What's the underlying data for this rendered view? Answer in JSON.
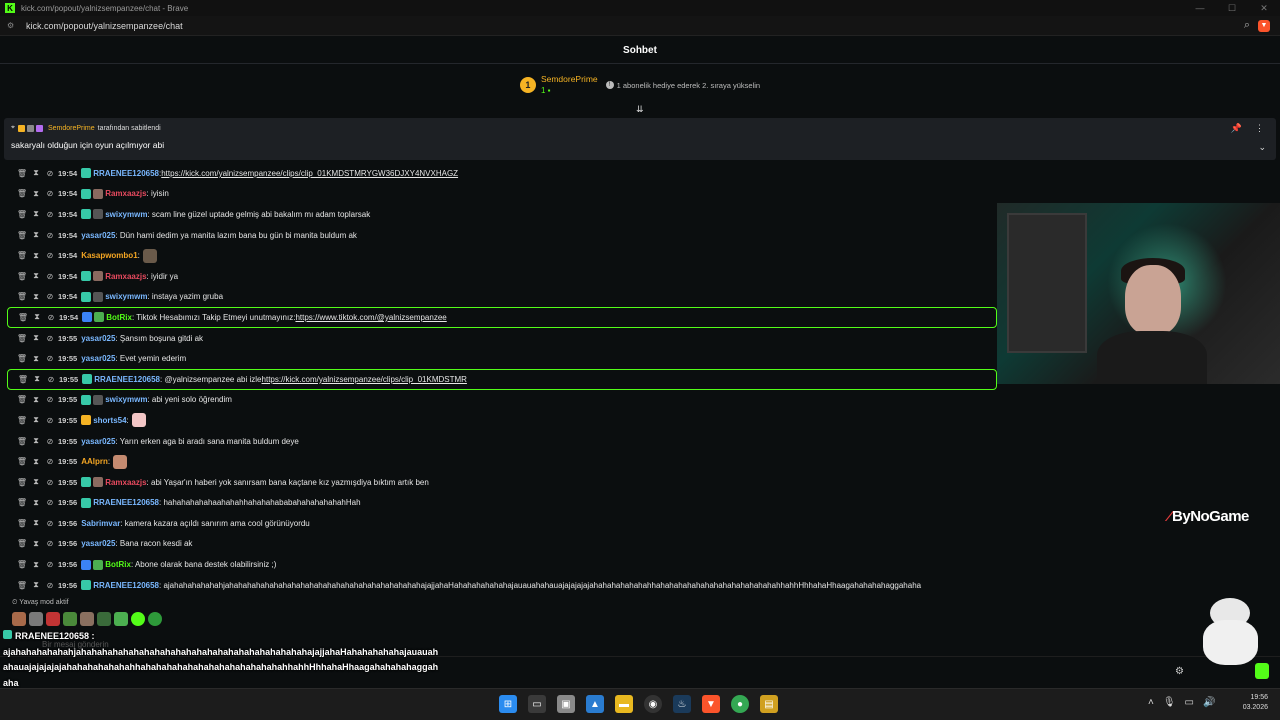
{
  "window": {
    "title": "kick.com/popout/yalnizsempanzee/chat - Brave",
    "url": "kick.com/popout/yalnizsempanzee/chat"
  },
  "chat": {
    "header": "Sohbet",
    "leader": {
      "rank": "1",
      "username": "SemdorePrime",
      "count": "1",
      "hint": "1 abonelik hediye ederek 2. sıraya yükselin"
    },
    "pinned": {
      "by": "SemdorePrime",
      "suffix": "tarafından sabitlendi",
      "text": "sakaryalı olduğun için oyun açılmıyor abi"
    },
    "messages": [
      {
        "time": "19:54",
        "user": "RRAENEE120658",
        "color": "#7ab8ff",
        "text": ": ",
        "link": "https://kick.com/yalnizsempanzee/clips/clip_01KMDSTMRYGW36DJXY4NVXHAGZ",
        "badges": [
          "#37c9a8"
        ]
      },
      {
        "time": "19:54",
        "user": "Ramxaazjs",
        "color": "#e84a5f",
        "text": ": iyisin",
        "badges": [
          "#37c9a8",
          "#8a6a60"
        ]
      },
      {
        "time": "19:54",
        "user": "swixymwm",
        "color": "#7ab8ff",
        "text": ": scam line güzel uptade gelmiş abi bakalım mı adam toplarsak",
        "badges": [
          "#37c9a8",
          "#555"
        ]
      },
      {
        "time": "19:54",
        "user": "yasar025",
        "color": "#7ab8ff",
        "text": ": Dün hami dedim ya manita lazım bana bu gün bi manita buldum ak",
        "badges": []
      },
      {
        "time": "19:54",
        "user": "Kasapwombo1",
        "color": "#f5a623",
        "text": ":",
        "badges": [],
        "emote": "#6a5a4a"
      },
      {
        "time": "19:54",
        "user": "Ramxaazjs",
        "color": "#e84a5f",
        "text": ": iyidir ya",
        "badges": [
          "#37c9a8",
          "#8a6a60"
        ]
      },
      {
        "time": "19:54",
        "user": "swixymwm",
        "color": "#7ab8ff",
        "text": ": instaya yazim gruba",
        "badges": [
          "#37c9a8",
          "#555"
        ]
      },
      {
        "time": "19:54",
        "user": "BotRix",
        "color": "#53fc18",
        "text": ": Tiktok Hesabımızı Takip Etmeyi unutmayınız: ",
        "link": "https://www.tiktok.com/@yalnizsempanzee",
        "badges": [
          "#3b82f6",
          "#4caf50"
        ],
        "highlight": true
      },
      {
        "time": "19:55",
        "user": "yasar025",
        "color": "#7ab8ff",
        "text": ": Şansım boşuna gitdi ak",
        "badges": []
      },
      {
        "time": "19:55",
        "user": "yasar025",
        "color": "#7ab8ff",
        "text": ": Evet yemin ederim",
        "badges": []
      },
      {
        "time": "19:55",
        "user": "RRAENEE120658",
        "color": "#7ab8ff",
        "text": ": @yalnizsempanzee abi izle ",
        "link": "https://kick.com/yalnizsempanzee/clips/clip_01KMDSTMR",
        "badges": [
          "#37c9a8"
        ],
        "highlight": true
      },
      {
        "time": "19:55",
        "user": "swixymwm",
        "color": "#7ab8ff",
        "text": ": abi yeni solo öğrendim",
        "badges": [
          "#37c9a8",
          "#555"
        ]
      },
      {
        "time": "19:55",
        "user": "shorts54",
        "color": "#7ab8ff",
        "text": ":",
        "badges": [
          "#f5b324"
        ],
        "emote": "#f3c6c6"
      },
      {
        "time": "19:55",
        "user": "yasar025",
        "color": "#7ab8ff",
        "text": ": Yarın erken aga bi aradı sana manita buldum deye",
        "badges": []
      },
      {
        "time": "19:55",
        "user": "AAlprn",
        "color": "#f5a623",
        "text": ":",
        "badges": [],
        "emote": "#c48a70"
      },
      {
        "time": "19:55",
        "user": "Ramxaazjs",
        "color": "#e84a5f",
        "text": ": abi Yaşar'ın haberi yok sanırsam bana kaçtane kız yazmışdiya bıktım artık ben",
        "badges": [
          "#37c9a8",
          "#8a6a60"
        ]
      },
      {
        "time": "19:56",
        "user": "RRAENEE120658",
        "color": "#7ab8ff",
        "text": ": hahahahahahaahahahhahahahababahahahahahahHah",
        "badges": [
          "#37c9a8"
        ]
      },
      {
        "time": "19:56",
        "user": "Sabrimvar",
        "color": "#7ab8ff",
        "text": ": kamera kazara açıldı sanırım ama cool görünüyordu",
        "badges": []
      },
      {
        "time": "19:56",
        "user": "yasar025",
        "color": "#7ab8ff",
        "text": ": Bana racon kesdi ak",
        "badges": []
      },
      {
        "time": "19:56",
        "user": "BotRix",
        "color": "#53fc18",
        "text": ": Abone olarak bana destek olabilirsiniz ;)",
        "badges": [
          "#3b82f6",
          "#4caf50"
        ]
      },
      {
        "time": "19:56",
        "user": "RRAENEE120658",
        "color": "#7ab8ff",
        "text": ": ajahahahahahahjahahahahahahahahahahahahahahahahahahahahahahajajjahaHahahahahahahajauauahahauajajajajajahahahahahahahhahahahahahahahahahahahahahahhahhHhhahaHhaagahahahahaggahaha",
        "badges": [
          "#37c9a8"
        ]
      }
    ],
    "slow_mode": "Yavaş mod aktif",
    "input_placeholder": "Bir mesaj gönderin",
    "overlay": {
      "user": "RRAENEE120658 :",
      "text": "ajahahahahahahjahahahahahahahahahahahahahahahahahahahahahahajajjahaHahahahahahajauauahahauajajajajajahahahahahahahhahahahahahahahahahahahahahahhahhHhhahaHhaagahahahahaggahaha"
    }
  },
  "watermark": "ByNoGame",
  "clock": {
    "time": "19:56",
    "date": "03.2026"
  },
  "colors": {
    "accent": "#53fc18",
    "gold": "#f5b324"
  }
}
